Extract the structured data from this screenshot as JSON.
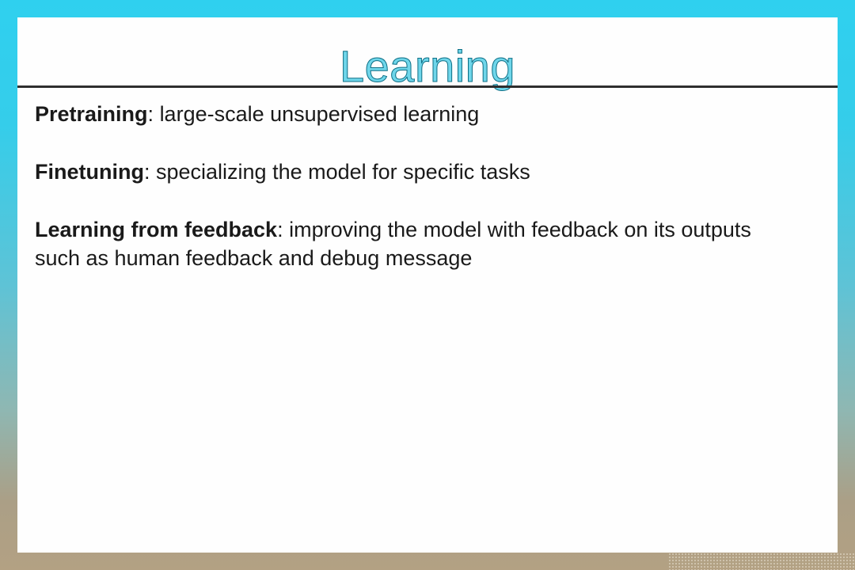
{
  "slide": {
    "title": "Learning",
    "items": [
      {
        "term": "Pretraining",
        "separator": ":",
        "lines": [
          "large-scale unsupervised learning"
        ]
      },
      {
        "term": "Finetuning",
        "separator": ":",
        "lines": [
          "specializing the model for specific tasks"
        ]
      },
      {
        "term": "Learning from feedback",
        "separator": ":",
        "lines": [
          "improving the model with feedback on its outputs",
          "such as human feedback and debug message"
        ]
      }
    ]
  },
  "colors": {
    "title_fill": "#6fd6ea",
    "title_outline": "#0d6f86",
    "body_text": "#1a1a1a",
    "slide_background": "#fefefe",
    "frame_top": "#2fd0ef",
    "frame_bottom": "#b3a183"
  }
}
